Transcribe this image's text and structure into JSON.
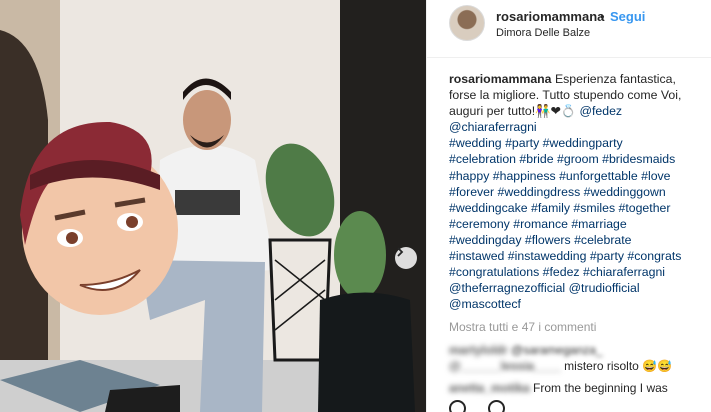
{
  "post": {
    "username": "rosariomammana",
    "separator": "•",
    "follow_label": "Segui",
    "location": "Dimora Delle Balze",
    "caption_lines": [
      "Esperienza fantastica,",
      "forse la migliore. Tutto stupendo come Voi,",
      "auguri per tutto!",
      "@fedez",
      "@chiaraferragni",
      "#wedding #party #weddingparty",
      "#celebration #bride #groom #bridesmaids",
      "#happy #happiness #unforgettable #love",
      "#forever #weddingdress #weddinggown",
      "#weddingcake #family #smiles #together",
      "#ceremony #romance #marriage",
      "#weddingday #flowers #celebrate",
      "#instawed #instawedding #party #congrats",
      "#congratulations #fedez #chiaraferragni",
      "@theferragnezofficial @trudiofficial",
      "@mascottecf"
    ],
    "caption_emoji": "👫❤💍",
    "show_all_comments": "Mostra tutti e 47 i commenti",
    "comments": [
      {
        "user": "martyloldr",
        "text": "@sarameganza_"
      },
      {
        "user": "@______lessia____",
        "text": "mistero risolto 😅😅"
      },
      {
        "user": "anetta_motika",
        "text": "From the beginning I was"
      }
    ]
  },
  "icons": {
    "avatar": "profile-avatar",
    "next": "chevron-right-icon"
  }
}
